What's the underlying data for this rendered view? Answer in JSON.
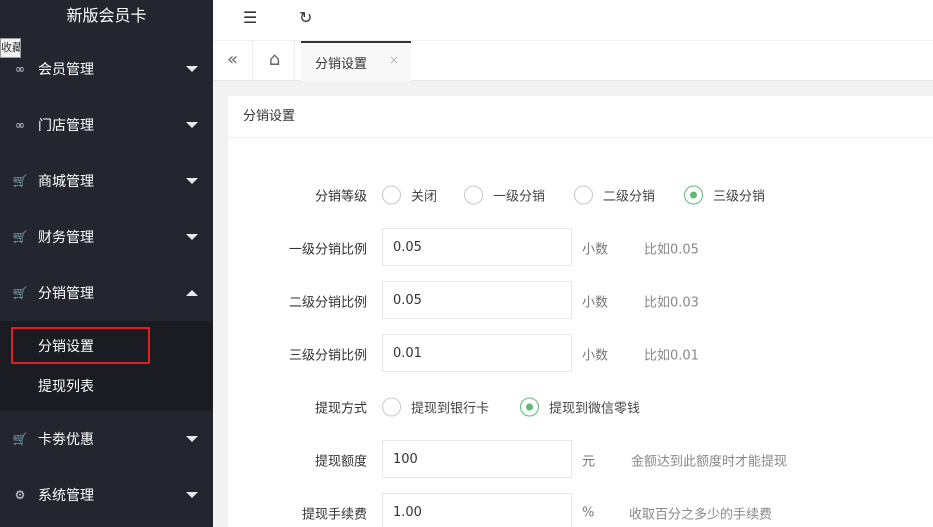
{
  "sidebar": {
    "brand": "新版会员卡",
    "collect_tag": "收藏",
    "items": [
      {
        "label": "会员管理",
        "icon": "∞"
      },
      {
        "label": "门店管理",
        "icon": "∞"
      },
      {
        "label": "商城管理",
        "icon": "🛒"
      },
      {
        "label": "财务管理",
        "icon": "🛒"
      },
      {
        "label": "分销管理",
        "icon": "🛒"
      },
      {
        "label": "卡劵优惠",
        "icon": "🛒"
      },
      {
        "label": "系统管理",
        "icon": "⚙"
      }
    ],
    "sub_items": [
      {
        "label": "分销设置"
      },
      {
        "label": "提现列表"
      }
    ]
  },
  "topbar": {
    "menu_icon": "☰",
    "refresh_icon": "↻"
  },
  "tabs": {
    "collapse_icon": "«",
    "home_icon": "⌂",
    "active_label": "分销设置",
    "close_icon": "×"
  },
  "card": {
    "title": "分销设置"
  },
  "form": {
    "level": {
      "label": "分销等级",
      "options": [
        "关闭",
        "一级分销",
        "二级分销",
        "三级分销"
      ],
      "selected": "三级分销"
    },
    "ratio1": {
      "label": "一级分销比例",
      "value": "0.05",
      "unit": "小数",
      "hint": "比如0.05"
    },
    "ratio2": {
      "label": "二级分销比例",
      "value": "0.05",
      "unit": "小数",
      "hint": "比如0.03"
    },
    "ratio3": {
      "label": "三级分销比例",
      "value": "0.01",
      "unit": "小数",
      "hint": "比如0.01"
    },
    "withdraw_method": {
      "label": "提现方式",
      "options": [
        "提现到银行卡",
        "提现到微信零钱"
      ],
      "selected": "提现到微信零钱"
    },
    "withdraw_amount": {
      "label": "提现额度",
      "value": "100",
      "unit": "元",
      "hint": "金额达到此额度时才能提现"
    },
    "withdraw_fee": {
      "label": "提现手续费",
      "value": "1.00",
      "unit": "%",
      "hint": "收取百分之多少的手续费"
    }
  },
  "colors": {
    "sidebar_bg": "#23262e",
    "submenu_bg": "#1a1c22",
    "radio_checked": "#5fb878",
    "highlight_border": "#e02020"
  }
}
